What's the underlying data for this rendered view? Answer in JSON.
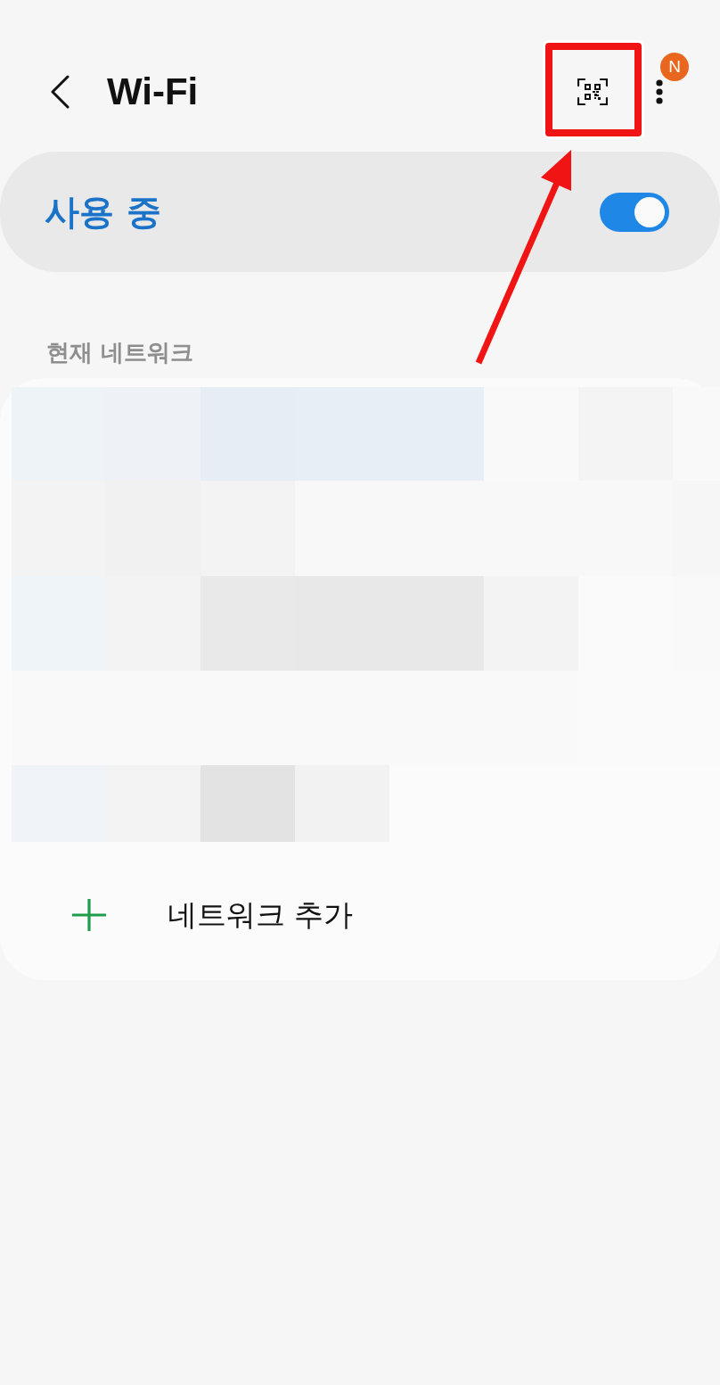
{
  "header": {
    "title": "Wi-Fi",
    "badge": "N"
  },
  "master_switch": {
    "label": "사용 중",
    "on": true
  },
  "current_network": {
    "heading": "현재 네트워크",
    "pixelated": true
  },
  "add_network": {
    "label": "네트워크 추가"
  },
  "annotation": {
    "frame": true,
    "arrow": true
  }
}
